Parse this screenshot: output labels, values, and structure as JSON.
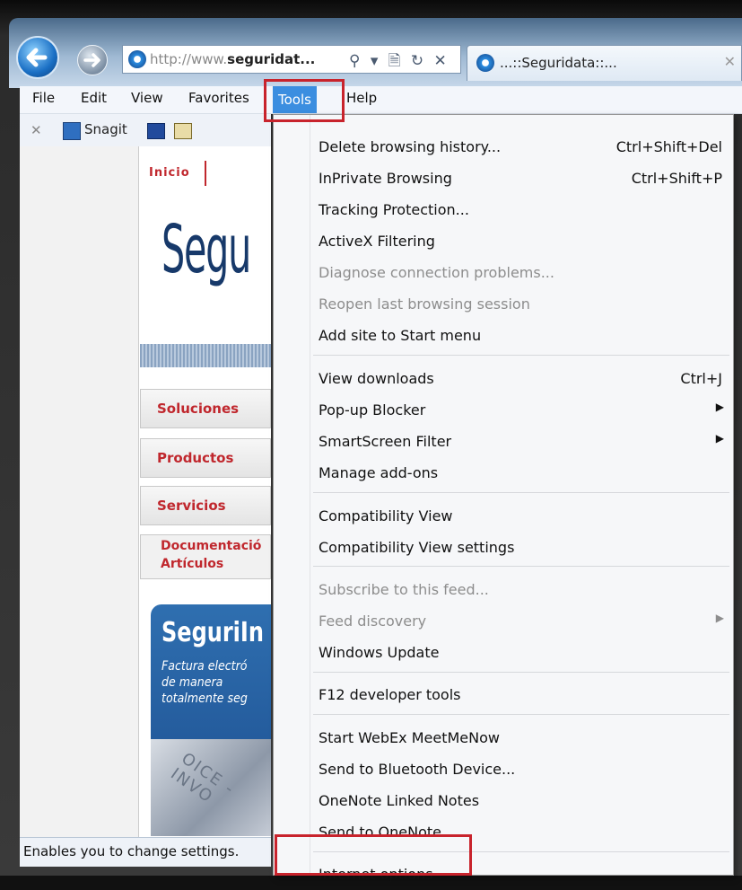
{
  "browser": {
    "address": {
      "url_prefix": "http://www.",
      "url_domain": "seguridat...",
      "icons": "⚲ ▾ 🗎 ↻ ✕"
    },
    "tab": {
      "title": "...::Seguridata::...",
      "close": "✕"
    }
  },
  "menubar": {
    "items": [
      {
        "label": "File"
      },
      {
        "label": "Edit"
      },
      {
        "label": "View"
      },
      {
        "label": "Favorites"
      },
      {
        "label": "Tools"
      },
      {
        "label": "Help"
      }
    ]
  },
  "toolbar": {
    "close": "✕",
    "snagit_label": "Snagit"
  },
  "webpage": {
    "inicio": "Inicio",
    "brand": "Segu",
    "nav": [
      {
        "label": "Soluciones"
      },
      {
        "label": "Productos"
      },
      {
        "label": "Servicios"
      }
    ],
    "doc_label": "Documentació",
    "articulos_label": "Artículos",
    "promo": {
      "title": "SeguriIn",
      "subtitle": "Factura electró\nde manera\ntotalmente seg",
      "image_text": "OICE - INVO"
    }
  },
  "statusbar": {
    "text": "Enables you to change settings."
  },
  "tools_menu": {
    "items": [
      {
        "label": "Delete browsing history...",
        "shortcut": "Ctrl+Shift+Del",
        "disabled": false
      },
      {
        "label": "InPrivate Browsing",
        "shortcut": "Ctrl+Shift+P",
        "disabled": false
      },
      {
        "label": "Tracking Protection...",
        "shortcut": "",
        "disabled": false
      },
      {
        "label": "ActiveX Filtering",
        "shortcut": "",
        "disabled": false
      },
      {
        "label": "Diagnose connection problems...",
        "shortcut": "",
        "disabled": true
      },
      {
        "label": "Reopen last browsing session",
        "shortcut": "",
        "disabled": true
      },
      {
        "label": "Add site to Start menu",
        "shortcut": "",
        "disabled": false
      },
      {
        "label": "View downloads",
        "shortcut": "Ctrl+J",
        "disabled": false
      },
      {
        "label": "Pop-up Blocker",
        "shortcut": "",
        "submenu": true,
        "disabled": false
      },
      {
        "label": "SmartScreen Filter",
        "shortcut": "",
        "submenu": true,
        "disabled": false
      },
      {
        "label": "Manage add-ons",
        "shortcut": "",
        "disabled": false
      },
      {
        "label": "Compatibility View",
        "shortcut": "",
        "disabled": false
      },
      {
        "label": "Compatibility View settings",
        "shortcut": "",
        "disabled": false
      },
      {
        "label": "Subscribe to this feed...",
        "shortcut": "",
        "disabled": true
      },
      {
        "label": "Feed discovery",
        "shortcut": "",
        "submenu": true,
        "disabled": true
      },
      {
        "label": "Windows Update",
        "shortcut": "",
        "disabled": false
      },
      {
        "label": "F12 developer tools",
        "shortcut": "",
        "disabled": false
      },
      {
        "label": "Start WebEx MeetMeNow",
        "shortcut": "",
        "disabled": false
      },
      {
        "label": "Send to Bluetooth Device...",
        "shortcut": "",
        "disabled": false
      },
      {
        "label": "OneNote Linked Notes",
        "shortcut": "",
        "disabled": false
      },
      {
        "label": "Send to OneNote",
        "shortcut": "",
        "disabled": false
      },
      {
        "label": "Internet options",
        "shortcut": "",
        "disabled": false
      }
    ],
    "submenu_arrow": "▶"
  },
  "highlight_color": "#c8232c"
}
